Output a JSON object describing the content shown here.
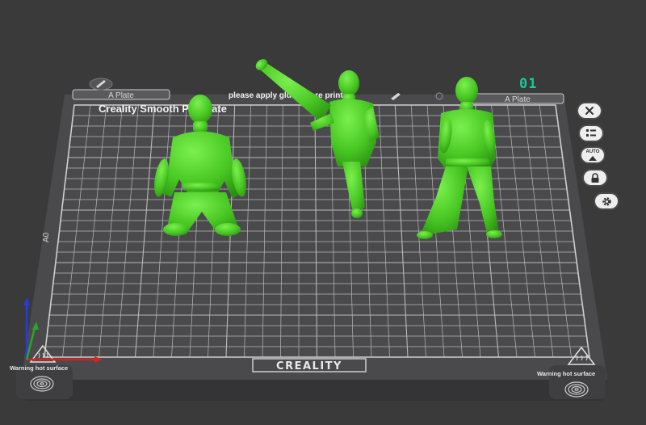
{
  "plate": {
    "tab_left": "A Plate",
    "tab_right": "A Plate",
    "number": "01",
    "title": "Creality Smooth PEI Plate",
    "notice": "please apply glue before print",
    "brand": "CREALITY",
    "warning_left": "Warning hot surface",
    "warning_right": "Warning hot surface",
    "side_label": "A0"
  },
  "models": [
    {
      "name": "kneeling-karate-figure",
      "color": "#4fd62a"
    },
    {
      "name": "kicking-karate-figure",
      "color": "#4fd62a"
    },
    {
      "name": "standing-karate-figure",
      "color": "#4fd62a"
    }
  ],
  "toolbar": {
    "close_icon": "close-icon",
    "arrange_icon": "list-icon",
    "auto_orient_label": "AUTO",
    "lock_icon": "lock-icon",
    "settings_icon": "gear-icon"
  },
  "colors": {
    "background": "#3a3a3b",
    "plate": "#4b4b4d",
    "grid": "#b9b9b9",
    "model": "#4fd62a",
    "plate_number": "#18c99a",
    "axis_x": "#d32222",
    "axis_y": "#2a3cd8",
    "axis_z": "#2aa62a"
  }
}
